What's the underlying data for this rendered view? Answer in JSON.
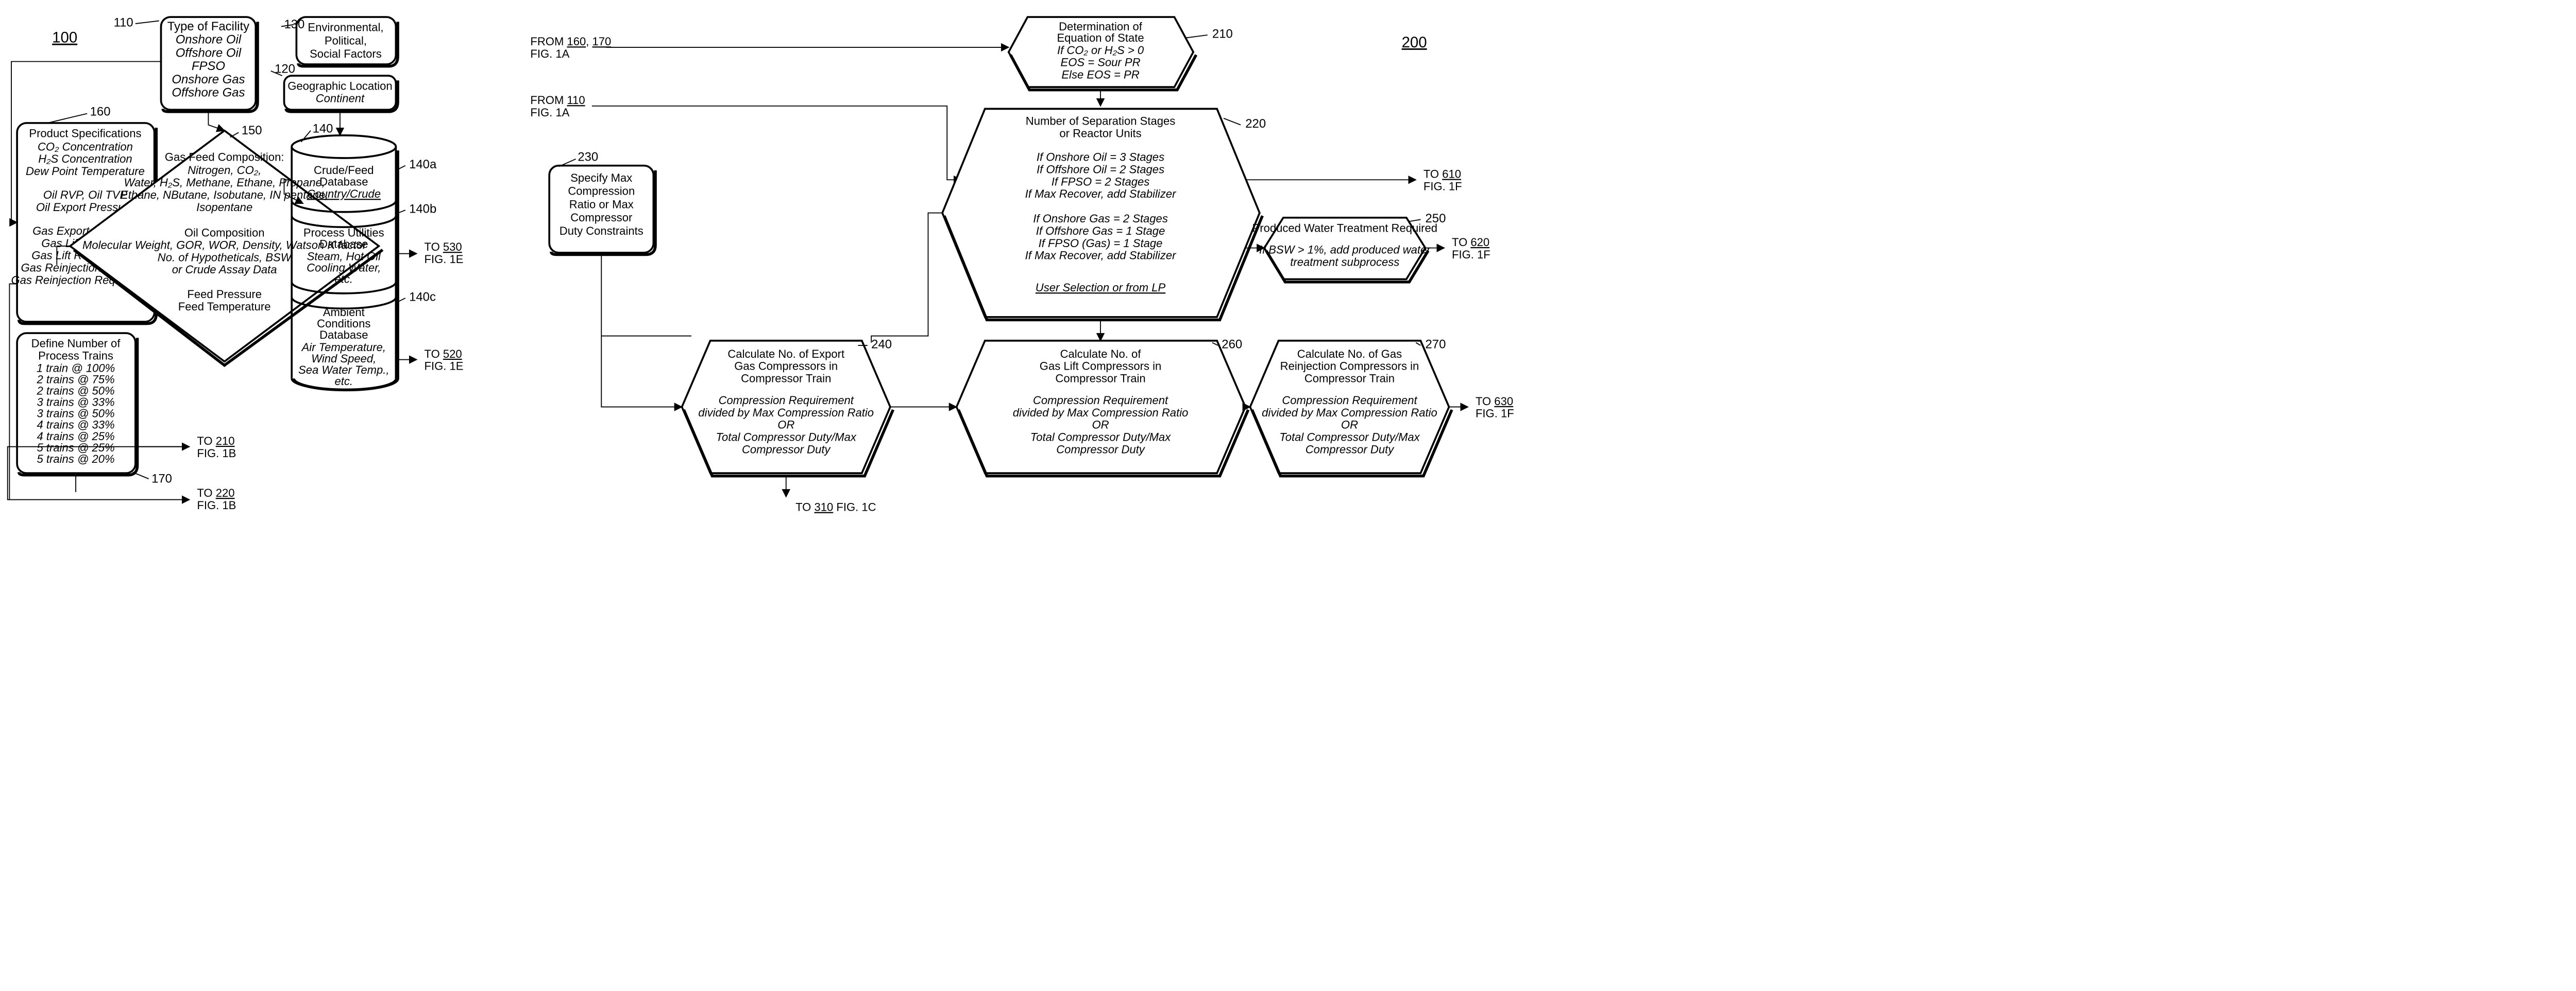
{
  "fig100": {
    "label": "100",
    "n110": {
      "tag": "110",
      "title": "Type of Facility",
      "lines": [
        "Onshore Oil",
        "Offshore Oil",
        "FPSO",
        "Onshore Gas",
        "Offshore Gas"
      ]
    },
    "n130": {
      "tag": "130",
      "lines": [
        "Environmental,",
        "Political,",
        "Social Factors"
      ]
    },
    "n120": {
      "tag": "120",
      "title": "Geographic Location",
      "sub": "Continent"
    },
    "n160": {
      "tag": "160",
      "title": "Product Specifications",
      "block1": [
        "CO₂ Concentration",
        "H₂S Concentration",
        "Dew Point Temperature"
      ],
      "block2": [
        "Oil RVP, Oil TVP",
        "Oil Export Pressure"
      ],
      "block3": [
        "Gas Export Pressure",
        "Gas Lift Pressure",
        "Gas Lift Requirement",
        "Gas Reinjection Pressure",
        "Gas Reinjection Requirement"
      ]
    },
    "n150": {
      "tag": "150",
      "gasTitle": "Gas Feed Composition:",
      "gasLines": [
        "Nitrogen, CO₂,",
        "Water, H₂S, Methane, Ethane, Propane,",
        "Ethane, NButane, Isobutane, IN pentane,",
        "Isopentane"
      ],
      "oilTitle": "Oil Composition",
      "oilLines": [
        "Molecular Weight, GOR, WOR, Density, Watson K factor",
        "No. of Hypotheticals, BSW",
        "or Crude Assay Data"
      ],
      "feed": [
        "Feed Pressure",
        "Feed Temperature"
      ]
    },
    "n140": {
      "tag": "140",
      "a": {
        "tag": "140a",
        "title": "Crude/Feed Database",
        "sub": "Country/Crude"
      },
      "b": {
        "tag": "140b",
        "title": "Process Utilities Database",
        "lines": [
          "Steam, Hot Oil",
          "Cooling Water,",
          "etc."
        ]
      },
      "c": {
        "tag": "140c",
        "title": "Ambient Conditions Database",
        "lines": [
          "Air Temperature,",
          "Wind Speed,",
          "Sea Water Temp.,",
          "etc."
        ]
      }
    },
    "n170": {
      "tag": "170",
      "title": "Define Number of Process Trains",
      "lines": [
        "1 train @ 100%",
        "2 trains @ 75%",
        "2 trains @ 50%",
        "3 trains @ 33%",
        "3 trains @ 50%",
        "4 trains @ 33%",
        "4 trains @ 25%",
        "5 trains @ 25%",
        "5 trains @ 20%"
      ]
    },
    "links": {
      "to530": {
        "to": "TO 530",
        "fig": "FIG. 1E"
      },
      "to520": {
        "to": "TO 520",
        "fig": "FIG. 1E"
      },
      "to210": {
        "to": "TO 210",
        "fig": "FIG. 1B"
      },
      "to220": {
        "to": "TO 220",
        "fig": "FIG. 1B"
      }
    }
  },
  "fig200": {
    "label": "200",
    "from160": {
      "lines": [
        "FROM 160, 170",
        "FIG. 1A"
      ]
    },
    "from110": {
      "lines": [
        "FROM 110",
        "FIG. 1A"
      ]
    },
    "n210": {
      "tag": "210",
      "title": [
        "Determination of",
        "Equation of State"
      ],
      "lines": [
        "If CO₂ or H₂S > 0",
        "EOS = Sour PR",
        "Else EOS = PR"
      ]
    },
    "n220": {
      "tag": "220",
      "title": [
        "Number of Separation Stages",
        "or Reactor Units"
      ],
      "block1": [
        "If Onshore Oil = 3 Stages",
        "If Offshore Oil = 2 Stages",
        "If FPSO = 2 Stages",
        "If Max Recover, add Stabilizer"
      ],
      "block2": [
        "If Onshore Gas = 2 Stages",
        "If Offshore Gas = 1 Stage",
        "If FPSO (Gas) = 1 Stage",
        "If Max Recover, add Stabilizer"
      ],
      "foot": "User Selection or from LP"
    },
    "n230": {
      "tag": "230",
      "lines": [
        "Specify Max",
        "Compression",
        "Ratio or Max",
        "Compressor",
        "Duty Constraints"
      ]
    },
    "n240": {
      "tag": "240",
      "title": [
        "Calculate No. of Export",
        "Gas Compressors in",
        "Compressor Train"
      ],
      "lines": [
        "Compression Requirement",
        "divided by Max Compression Ratio",
        "OR",
        "Total Compressor Duty/Max",
        "Compressor Duty"
      ]
    },
    "n250": {
      "tag": "250",
      "title": "Produced Water Treatment Required",
      "lines": [
        "If BSW > 1%, add produced water",
        "treatment subprocess"
      ]
    },
    "n260": {
      "tag": "260",
      "title": [
        "Calculate No. of",
        "Gas Lift Compressors in",
        "Compressor Train"
      ],
      "lines": [
        "Compression Requirement",
        "divided by Max Compression Ratio",
        "OR",
        "Total Compressor Duty/Max",
        "Compressor Duty"
      ]
    },
    "n270": {
      "tag": "270",
      "title": [
        "Calculate No. of Gas",
        "Reinjection Compressors in",
        "Compressor Train"
      ],
      "lines": [
        "Compression Requirement",
        "divided by Max Compression Ratio",
        "OR",
        "Total Compressor Duty/Max",
        "Compressor Duty"
      ]
    },
    "links": {
      "to610": {
        "to": "TO 610",
        "fig": "FIG. 1F"
      },
      "to620": {
        "to": "TO 620",
        "fig": "FIG. 1F"
      },
      "to630": {
        "to": "TO 630",
        "fig": "FIG. 1F"
      },
      "to310": {
        "to": "TO 310 FIG. 1C"
      }
    }
  }
}
